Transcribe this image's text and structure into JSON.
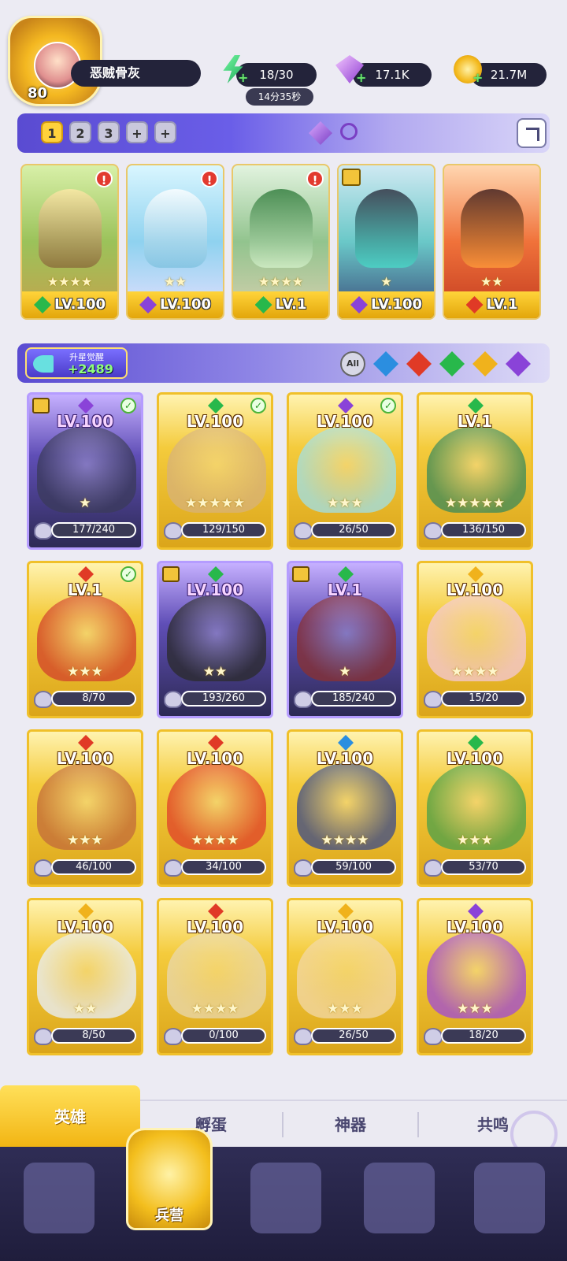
{
  "player": {
    "level": "80",
    "name": "恶贼骨灰"
  },
  "resources": {
    "energy": "18/30",
    "energy_timer": "14分35秒",
    "gems": "17.1K",
    "gold": "21.7M"
  },
  "team_tabs": [
    "1",
    "2",
    "3",
    "+",
    "+"
  ],
  "team_lineup": [
    {
      "level": "LV.100",
      "element": "green",
      "stars": "★★★★",
      "alert": "!"
    },
    {
      "level": "LV.100",
      "element": "purple",
      "stars": "★★",
      "alert": "!"
    },
    {
      "level": "LV.1",
      "element": "green",
      "stars": "★★★★",
      "alert": "!"
    },
    {
      "level": "LV.100",
      "element": "purple",
      "stars": "★",
      "alert": ""
    },
    {
      "level": "LV.1",
      "element": "red",
      "stars": "★★",
      "alert": ""
    }
  ],
  "awaken": {
    "label": "升星觉醒",
    "value": "+2489"
  },
  "filters": {
    "all_label": "All",
    "elements": [
      "blue",
      "red",
      "green",
      "gold",
      "purple"
    ]
  },
  "heroes": [
    {
      "level": "LV.100",
      "element": "purple",
      "shards": "177/240",
      "stars": "★",
      "style": "purple",
      "check": true,
      "class": true
    },
    {
      "level": "LV.100",
      "element": "green",
      "shards": "129/150",
      "stars": "★★★★★",
      "style": "gold",
      "check": true,
      "class": false
    },
    {
      "level": "LV.100",
      "element": "purple",
      "shards": "26/50",
      "stars": "★★★",
      "style": "gold",
      "check": true,
      "class": false
    },
    {
      "level": "LV.1",
      "element": "green",
      "shards": "136/150",
      "stars": "★★★★★",
      "style": "gold",
      "check": false,
      "class": false
    },
    {
      "level": "LV.1",
      "element": "red",
      "shards": "8/70",
      "stars": "★★★",
      "style": "gold",
      "check": true,
      "class": false
    },
    {
      "level": "LV.100",
      "element": "green",
      "shards": "193/260",
      "stars": "★★",
      "style": "purple",
      "check": false,
      "class": true
    },
    {
      "level": "LV.1",
      "element": "green",
      "shards": "185/240",
      "stars": "★",
      "style": "purple",
      "check": false,
      "class": true
    },
    {
      "level": "LV.100",
      "element": "gold",
      "shards": "15/20",
      "stars": "★★★★",
      "style": "gold",
      "check": false,
      "class": false
    },
    {
      "level": "LV.100",
      "element": "red",
      "shards": "46/100",
      "stars": "★★★",
      "style": "gold",
      "check": false,
      "class": false
    },
    {
      "level": "LV.100",
      "element": "red",
      "shards": "34/100",
      "stars": "★★★★",
      "style": "gold",
      "check": false,
      "class": false
    },
    {
      "level": "LV.100",
      "element": "blue",
      "shards": "59/100",
      "stars": "★★★★",
      "style": "gold",
      "check": false,
      "class": false
    },
    {
      "level": "LV.100",
      "element": "green",
      "shards": "53/70",
      "stars": "★★★",
      "style": "gold",
      "check": false,
      "class": false
    },
    {
      "level": "LV.100",
      "element": "gold",
      "shards": "8/50",
      "stars": "★★",
      "style": "gold",
      "check": false,
      "class": false
    },
    {
      "level": "LV.100",
      "element": "red",
      "shards": "0/100",
      "stars": "★★★★",
      "style": "gold",
      "check": false,
      "class": false
    },
    {
      "level": "LV.100",
      "element": "gold",
      "shards": "26/50",
      "stars": "★★★",
      "style": "gold",
      "check": false,
      "class": false
    },
    {
      "level": "LV.100",
      "element": "purple",
      "shards": "18/20",
      "stars": "★★★",
      "style": "gold",
      "check": false,
      "class": false
    }
  ],
  "subtabs": [
    "英雄",
    "孵蛋",
    "神器",
    "共鸣"
  ],
  "nav": {
    "active_label": "兵营",
    "items": [
      "cards-icon",
      "barracks-icon",
      "book-icon",
      "shop-icon",
      "guild-icon"
    ]
  },
  "colors": {
    "gold": "#f2b411",
    "purple_panel": "#5a4bd1",
    "nav_bg": "#2f2d55"
  }
}
